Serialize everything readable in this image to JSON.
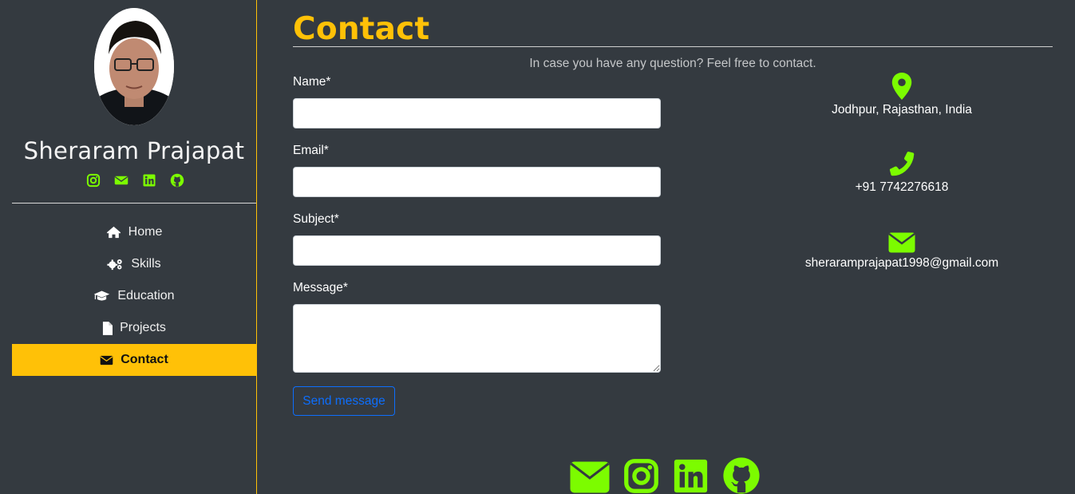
{
  "profile": {
    "name": "Sheraram Prajapat",
    "social": [
      "instagram-icon",
      "envelope-icon",
      "linkedin-icon",
      "github-icon"
    ]
  },
  "nav": {
    "items": [
      {
        "label": "Home",
        "icon": "home-icon"
      },
      {
        "label": "Skills",
        "icon": "gears-icon"
      },
      {
        "label": "Education",
        "icon": "graduation-cap-icon"
      },
      {
        "label": "Projects",
        "icon": "file-icon"
      },
      {
        "label": "Contact",
        "icon": "envelope-icon",
        "active": true
      }
    ]
  },
  "page": {
    "title": "Contact",
    "subtitle": "In case you have any question? Feel free to contact."
  },
  "form": {
    "name_label": "Name*",
    "email_label": "Email*",
    "subject_label": "Subject*",
    "message_label": "Message*",
    "submit_label": "Send message"
  },
  "contact_info": {
    "location": "Jodhpur, Rajasthan, India",
    "phone": "+91 7742276618",
    "email": "sheraramprajapat1998@gmail.com"
  },
  "footer": {
    "social": [
      "envelope-icon",
      "instagram-icon",
      "linkedin-icon",
      "github-icon"
    ]
  },
  "colors": {
    "background": "#343a40",
    "accent": "#ffc107",
    "icon_green": "#7cfc00",
    "button_blue": "#0d6efd"
  }
}
